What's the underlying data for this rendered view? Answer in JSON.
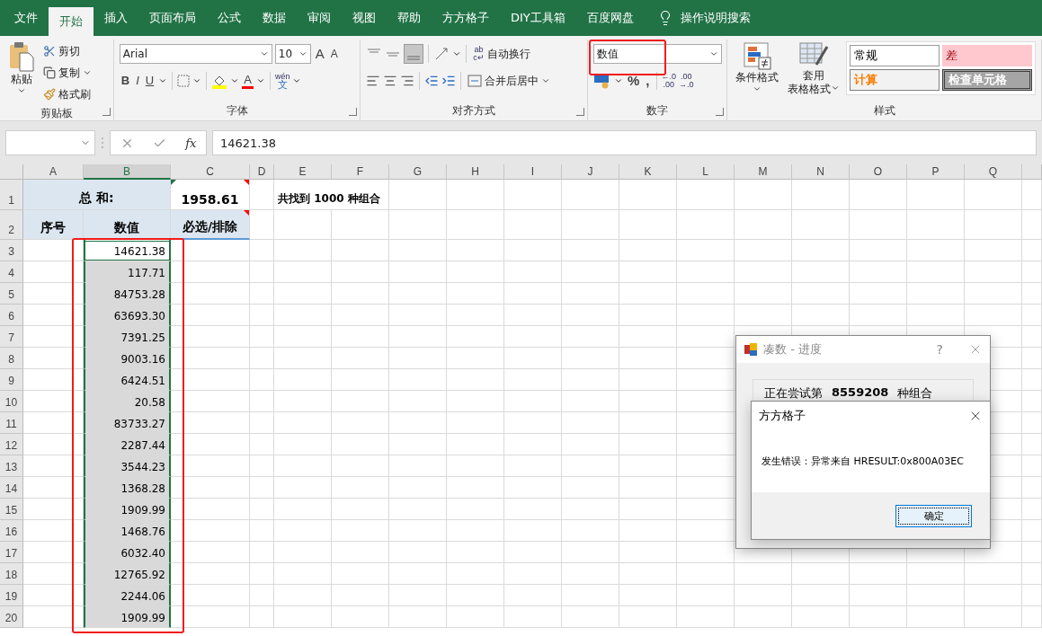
{
  "tabs": [
    {
      "label": "文件",
      "selected": false
    },
    {
      "label": "开始",
      "selected": true
    },
    {
      "label": "插入",
      "selected": false
    },
    {
      "label": "页面布局",
      "selected": false
    },
    {
      "label": "公式",
      "selected": false
    },
    {
      "label": "数据",
      "selected": false
    },
    {
      "label": "审阅",
      "selected": false
    },
    {
      "label": "视图",
      "selected": false
    },
    {
      "label": "帮助",
      "selected": false
    },
    {
      "label": "方方格子",
      "selected": false
    },
    {
      "label": "DIY工具箱",
      "selected": false
    },
    {
      "label": "百度网盘",
      "selected": false
    }
  ],
  "tell_me": "操作说明搜索",
  "clipboard": {
    "paste": "粘贴",
    "cut": "剪切",
    "copy": "复制",
    "format_painter": "格式刷",
    "label": "剪贴板"
  },
  "font": {
    "name": "Arial",
    "size": "10",
    "grow": "A",
    "shrink": "A",
    "bold": "B",
    "italic": "I",
    "underline": "U",
    "color_glyph": "A",
    "phonetic_top": "wén",
    "phonetic_bottom": "文",
    "label": "字体"
  },
  "alignment": {
    "wrap_icon": [
      "ab",
      "c↵"
    ],
    "wrap": "自动换行",
    "merge": "合并后居中",
    "label": "对齐方式"
  },
  "number": {
    "format": "数值",
    "percent": "%",
    "comma": ",",
    "increase_decimal": [
      "←.0",
      ".00"
    ],
    "decrease_decimal": [
      ".00",
      "→.0"
    ],
    "label": "数字"
  },
  "styles": {
    "conditional": "条件格式",
    "table_format": [
      "套用",
      "表格格式"
    ],
    "cells": [
      {
        "label": "常规",
        "kind": "normal"
      },
      {
        "label": "差",
        "kind": "bad"
      },
      {
        "label": "计算",
        "kind": "calc"
      },
      {
        "label": "检查单元格",
        "kind": "check"
      }
    ],
    "label": "样式"
  },
  "formula_bar": {
    "fx": "fx",
    "value": "14621.38"
  },
  "columns": [
    {
      "label": "A",
      "selected": false
    },
    {
      "label": "B",
      "selected": true
    },
    {
      "label": "C",
      "selected": false
    },
    {
      "label": "D",
      "selected": false
    },
    {
      "label": "E",
      "selected": false
    },
    {
      "label": "F",
      "selected": false
    },
    {
      "label": "G",
      "selected": false
    },
    {
      "label": "H",
      "selected": false
    },
    {
      "label": "I",
      "selected": false
    },
    {
      "label": "J",
      "selected": false
    },
    {
      "label": "K",
      "selected": false
    },
    {
      "label": "L",
      "selected": false
    },
    {
      "label": "M",
      "selected": false
    },
    {
      "label": "N",
      "selected": false
    },
    {
      "label": "O",
      "selected": false
    },
    {
      "label": "P",
      "selected": false
    },
    {
      "label": "Q",
      "selected": false
    }
  ],
  "header_rows": [
    {
      "number": "1",
      "title": "总 和:",
      "total": "1958.61",
      "note": "共找到 1000 种组合"
    },
    {
      "number": "2",
      "index_label": "序号",
      "value_label": "数值",
      "choice_label": "必选/排除"
    }
  ],
  "rows": [
    {
      "number": "3",
      "value": "14621.38",
      "selected": true,
      "active": true
    },
    {
      "number": "4",
      "value": "117.71",
      "selected": true,
      "active": false
    },
    {
      "number": "5",
      "value": "84753.28",
      "selected": true,
      "active": false
    },
    {
      "number": "6",
      "value": "63693.30",
      "selected": true,
      "active": false
    },
    {
      "number": "7",
      "value": "7391.25",
      "selected": true,
      "active": false
    },
    {
      "number": "8",
      "value": "9003.16",
      "selected": true,
      "active": false
    },
    {
      "number": "9",
      "value": "6424.51",
      "selected": true,
      "active": false
    },
    {
      "number": "10",
      "value": "20.58",
      "selected": true,
      "active": false
    },
    {
      "number": "11",
      "value": "83733.27",
      "selected": true,
      "active": false
    },
    {
      "number": "12",
      "value": "2287.44",
      "selected": true,
      "active": false
    },
    {
      "number": "13",
      "value": "3544.23",
      "selected": true,
      "active": false
    },
    {
      "number": "14",
      "value": "1368.28",
      "selected": true,
      "active": false
    },
    {
      "number": "15",
      "value": "1909.99",
      "selected": true,
      "active": false
    },
    {
      "number": "16",
      "value": "1468.76",
      "selected": true,
      "active": false
    },
    {
      "number": "17",
      "value": "6032.40",
      "selected": true,
      "active": false
    },
    {
      "number": "18",
      "value": "12765.92",
      "selected": true,
      "active": false
    },
    {
      "number": "19",
      "value": "2244.06",
      "selected": true,
      "active": false
    },
    {
      "number": "20",
      "value": "1909.99",
      "selected": true,
      "active": false
    }
  ],
  "progress_dialog": {
    "title": "凑数 - 进度",
    "help": "?",
    "message": [
      "正在尝试第",
      "8559208",
      "种组合"
    ]
  },
  "error_dialog": {
    "title": "方方格子",
    "message": "发生错误：异常来自 HRESULT:0x800A03EC",
    "button": "确定"
  }
}
